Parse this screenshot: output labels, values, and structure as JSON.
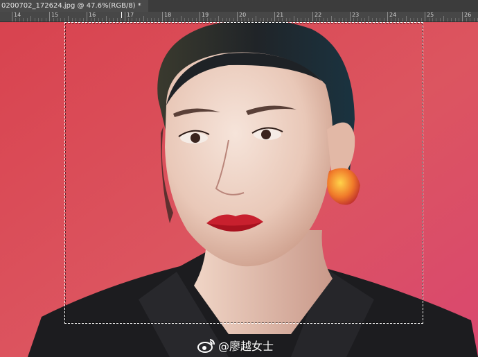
{
  "document": {
    "tab_title": "0200702_172624.jpg @ 47.6%(RGB/8) *"
  },
  "ruler": {
    "labels": [
      "14",
      "15",
      "16",
      "17",
      "18",
      "19",
      "20",
      "21",
      "22",
      "23",
      "24",
      "25",
      "26"
    ]
  },
  "canvas": {
    "background_color": "#d94a5a",
    "jacket_color": "#1c1c1f"
  },
  "watermark": {
    "icon": "weibo-icon",
    "text": "@廖越女士"
  }
}
